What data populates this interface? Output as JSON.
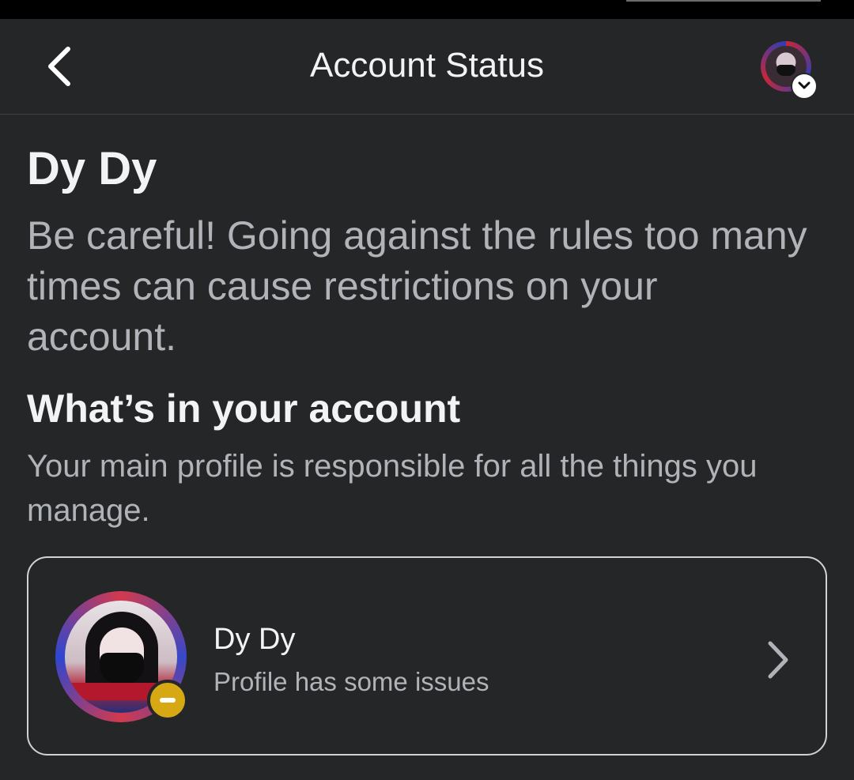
{
  "header": {
    "title": "Account Status",
    "back_icon": "chevron-left-icon",
    "switcher_icon": "chevron-down-icon"
  },
  "main": {
    "profile_name": "Dy Dy",
    "warning": "Be careful! Going against the rules too many times can cause restrictions on your account.",
    "section_title": "What’s in your account",
    "section_description": "Your main profile is responsible for all the things you manage.",
    "profile_card": {
      "name": "Dy Dy",
      "status": "Profile has some issues",
      "status_color": "#d6a914",
      "chevron_icon": "chevron-right-icon"
    }
  },
  "colors": {
    "background": "#252627",
    "text_primary": "#f2f3f5",
    "text_secondary": "#b0b3b8",
    "card_border": "#d0d2d6"
  }
}
